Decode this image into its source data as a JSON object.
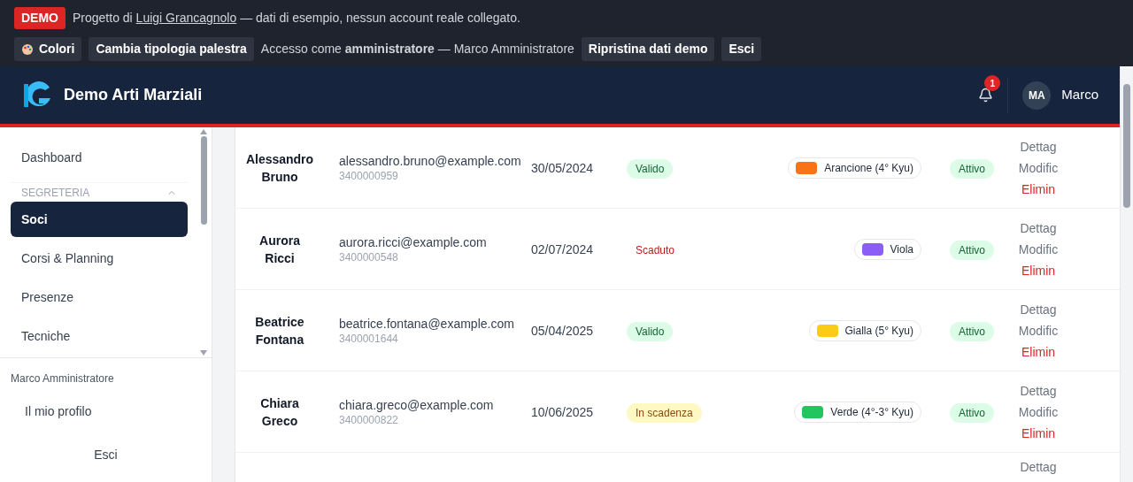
{
  "demo_bar": {
    "badge": "DEMO",
    "text_before": "Progetto di",
    "link": "Luigi Grancagnolo",
    "text_after": "— dati di esempio, nessun account reale collegato.",
    "colors_button": "Colori",
    "switch_button": "Cambia tipologia palestra",
    "access_text": "Accesso come **amministratore** — Marco Amministratore",
    "reset_button": "Ripristina dati demo",
    "exit_button": "Esci"
  },
  "header": {
    "title": "Demo Arti Marziali",
    "notification_count": "1",
    "avatar_initials": "MA",
    "user_name": "Marco"
  },
  "sidebar": {
    "items": [
      {
        "kind": "item",
        "label": "Dashboard",
        "selected": false
      },
      {
        "kind": "section",
        "label": "SEGRETERIA",
        "expanded": true
      },
      {
        "kind": "item",
        "label": "Soci",
        "selected": true
      },
      {
        "kind": "item",
        "label": "Corsi & Planning",
        "selected": false
      },
      {
        "kind": "item",
        "label": "Presenze",
        "selected": false
      },
      {
        "kind": "item",
        "label": "Tecniche",
        "selected": false
      }
    ],
    "user_label": "Marco Amministratore",
    "profile_link": "Il mio profilo",
    "logout": "Esci"
  },
  "table": {
    "rows": [
      {
        "name": "Alessandro Bruno",
        "email": "alessandro.bruno@example.com",
        "phone": "3400000959",
        "date": "30/05/2024",
        "certificate": {
          "kind": "valid",
          "label": "Valido"
        },
        "belt": {
          "label": "Arancione (4° Kyu)",
          "color": "#f97316"
        },
        "status": "Attivo",
        "actions": [
          "Dettag",
          "Modific",
          "Elimin"
        ]
      },
      {
        "name": "Aurora Ricci",
        "email": "aurora.ricci@example.com",
        "phone": "3400000548",
        "date": "02/07/2024",
        "certificate": {
          "kind": "expired",
          "label": "Scaduto"
        },
        "belt": {
          "label": "Viola",
          "color": "#8b5cf6"
        },
        "status": "Attivo",
        "actions": [
          "Dettag",
          "Modific",
          "Elimin"
        ]
      },
      {
        "name": "Beatrice Fontana",
        "email": "beatrice.fontana@example.com",
        "phone": "3400001644",
        "date": "05/04/2025",
        "certificate": {
          "kind": "valid",
          "label": "Valido"
        },
        "belt": {
          "label": "Gialla (5° Kyu)",
          "color": "#facc15"
        },
        "status": "Attivo",
        "actions": [
          "Dettag",
          "Modific",
          "Elimin"
        ]
      },
      {
        "name": "Chiara Greco",
        "email": "chiara.greco@example.com",
        "phone": "3400000822",
        "date": "10/06/2025",
        "certificate": {
          "kind": "expiring",
          "label": "In scadenza"
        },
        "belt": {
          "label": "Verde (4°-3° Kyu)",
          "color": "#22c55e"
        },
        "status": "Attivo",
        "actions": [
          "Dettag",
          "Modific",
          "Elimin"
        ]
      },
      {
        "actions": [
          "Dettag"
        ]
      }
    ]
  }
}
